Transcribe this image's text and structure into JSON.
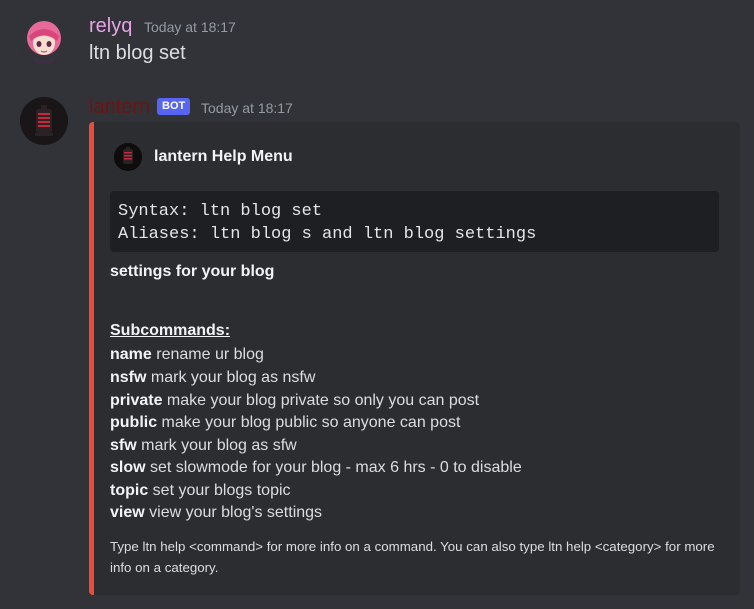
{
  "messages": [
    {
      "username": "relyq",
      "username_color": "#e8a2e8",
      "timestamp": "Today at 18:17",
      "text": "ltn blog set"
    },
    {
      "username": "lantern",
      "username_color": "#6b1414",
      "bot_tag": "BOT",
      "timestamp": "Today at 18:17"
    }
  ],
  "embed": {
    "accent_color": "#e94b3c",
    "author_name": "lantern Help Menu",
    "code_lines": [
      "Syntax: ltn blog set",
      "Aliases: ltn blog s and ltn blog settings"
    ],
    "description": "settings for your blog",
    "subcommands_heading": "Subcommands:",
    "subcommands": [
      {
        "name": "name",
        "desc": " rename ur blog"
      },
      {
        "name": "nsfw",
        "desc": " mark your blog as nsfw"
      },
      {
        "name": "private",
        "desc": " make your blog private so only you can post"
      },
      {
        "name": "public",
        "desc": " make your blog public so anyone can post"
      },
      {
        "name": "sfw",
        "desc": " mark your blog as sfw"
      },
      {
        "name": "slow",
        "desc": " set slowmode for your blog - max 6 hrs - 0 to disable"
      },
      {
        "name": "topic",
        "desc": " set your blogs topic"
      },
      {
        "name": "view",
        "desc": " view your blog's settings"
      }
    ],
    "footer": "Type ltn help <command> for more info on a command. You can also type ltn help <category> for more info on a category."
  }
}
